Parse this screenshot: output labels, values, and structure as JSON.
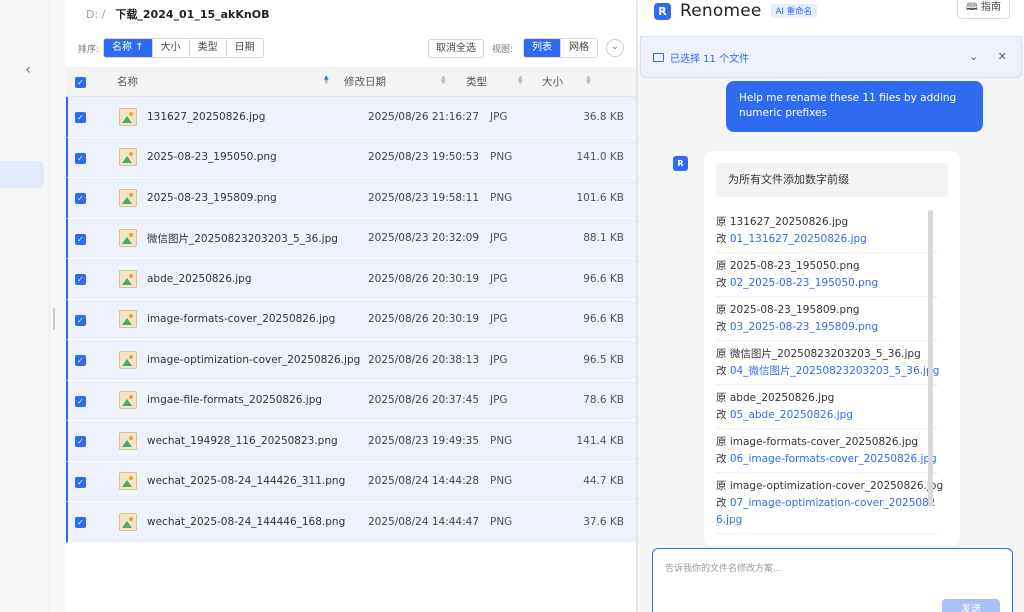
{
  "path": {
    "drive": "D:  /",
    "folder": "下载_2024_01_15_akKnOB"
  },
  "toolbar": {
    "sort_label": "排序:",
    "sort_options": [
      "名称 ↑",
      "大小",
      "类型",
      "日期"
    ],
    "deselect_all": "取消全选",
    "view_label": "视图:",
    "view_options": [
      "列表",
      "网格"
    ],
    "more": "⌄"
  },
  "table": {
    "headers": {
      "name": "名称",
      "date": "修改日期",
      "type": "类型",
      "size": "大小"
    },
    "rows": [
      {
        "name": "131627_20250826.jpg",
        "date": "2025/08/26 21:16:27",
        "type": "JPG",
        "size": "36.8 KB"
      },
      {
        "name": "2025-08-23_195050.png",
        "date": "2025/08/23 19:50:53",
        "type": "PNG",
        "size": "141.0 KB"
      },
      {
        "name": "2025-08-23_195809.png",
        "date": "2025/08/23 19:58:11",
        "type": "PNG",
        "size": "101.6 KB"
      },
      {
        "name": "微信图片_20250823203203_5_36.jpg",
        "date": "2025/08/23 20:32:09",
        "type": "JPG",
        "size": "88.1 KB"
      },
      {
        "name": "abde_20250826.jpg",
        "date": "2025/08/26 20:30:19",
        "type": "JPG",
        "size": "96.6 KB"
      },
      {
        "name": "image-formats-cover_20250826.jpg",
        "date": "2025/08/26 20:30:19",
        "type": "JPG",
        "size": "96.6 KB"
      },
      {
        "name": "image-optimization-cover_20250826.jpg",
        "date": "2025/08/26 20:38:13",
        "type": "JPG",
        "size": "96.5 KB"
      },
      {
        "name": "imgae-file-formats_20250826.jpg",
        "date": "2025/08/26 20:37:45",
        "type": "JPG",
        "size": "78.6 KB"
      },
      {
        "name": "wechat_194928_116_20250823.png",
        "date": "2025/08/23 19:49:35",
        "type": "PNG",
        "size": "141.4 KB"
      },
      {
        "name": "wechat_2025-08-24_144426_311.png",
        "date": "2025/08/24 14:44:28",
        "type": "PNG",
        "size": "44.7 KB"
      },
      {
        "name": "wechat_2025-08-24_144446_168.png",
        "date": "2025/08/24 14:44:47",
        "type": "PNG",
        "size": "37.6 KB"
      }
    ]
  },
  "assistant": {
    "app_name": "Renomee",
    "logo_letter": "R",
    "badge": "AI 重命名",
    "guide": "指南",
    "selection_text": "已选择 11 个文件",
    "user_message": "Help me rename these 11 files by adding numeric prefixes",
    "card_title": "为所有文件添加数字前缀",
    "orig_prefix": "原 ",
    "new_prefix": "改 ",
    "renames": [
      {
        "orig": "131627_20250826.jpg",
        "new": "01_131627_20250826.jpg"
      },
      {
        "orig": "2025-08-23_195050.png",
        "new": "02_2025-08-23_195050.png"
      },
      {
        "orig": "2025-08-23_195809.png",
        "new": "03_2025-08-23_195809.png"
      },
      {
        "orig": "微信图片_20250823203203_5_36.jpg",
        "new": "04_微信图片_20250823203203_5_36.jpg"
      },
      {
        "orig": "abde_20250826.jpg",
        "new": "05_abde_20250826.jpg"
      },
      {
        "orig": "image-formats-cover_20250826.jpg",
        "new": "06_image-formats-cover_20250826.jpg"
      },
      {
        "orig": "image-optimization-cover_20250826.jpg",
        "new": "07_image-optimization-cover_20250826.jpg"
      }
    ],
    "input_placeholder": "告诉我你的文件名修改方案...",
    "send_label": "发送"
  },
  "colors": {
    "accent": "#2f6bf0",
    "row_selected": "#edf2fc"
  }
}
